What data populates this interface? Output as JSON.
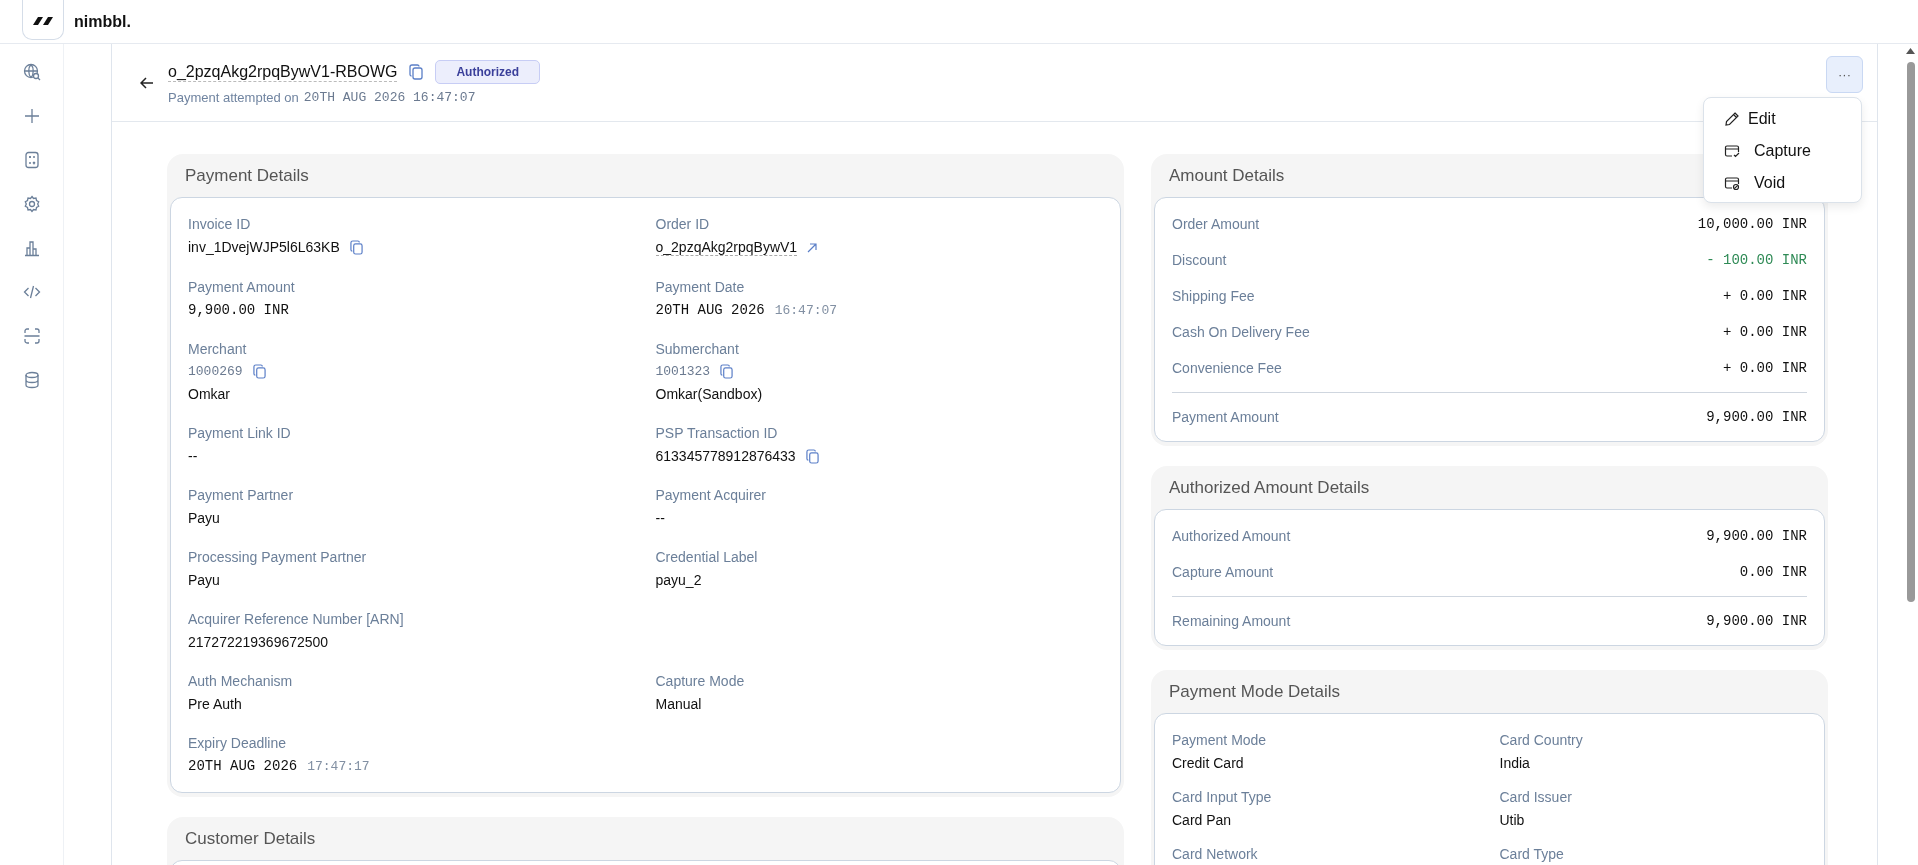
{
  "brand": {
    "name": "nimbbl."
  },
  "header": {
    "title": "o_2pzqAkg2rpqBywV1-RBOWG",
    "status": "Authorized",
    "subtitle_prefix": "Payment attempted on",
    "subtitle_date": "20TH AUG 2026 16:47:07",
    "more": "···"
  },
  "menu": [
    {
      "kind": "edit",
      "label": "Edit"
    },
    {
      "kind": "capture",
      "label": "Capture"
    },
    {
      "kind": "void",
      "label": "Void"
    }
  ],
  "payment_details": {
    "title": "Payment Details",
    "rows": [
      {
        "left": {
          "kind": "copy",
          "label": "Invoice ID",
          "value": "inv_1DvejWJP5l6L63KB"
        },
        "right": {
          "kind": "link",
          "label": "Order ID",
          "value": "o_2pzqAkg2rpqBywV1"
        }
      },
      {
        "left": {
          "kind": "mono",
          "label": "Payment Amount",
          "value": "9,900.00 INR"
        },
        "right": {
          "kind": "datetime",
          "label": "Payment Date",
          "value": "20TH AUG 2026",
          "time": "16:47:07"
        }
      },
      {
        "left": {
          "kind": "merchant",
          "label": "Merchant",
          "id": "1000269",
          "value": "Omkar"
        },
        "right": {
          "kind": "merchant",
          "label": "Submerchant",
          "id": "1001323",
          "value": "Omkar(Sandbox)"
        }
      },
      {
        "left": {
          "kind": "text",
          "label": "Payment Link ID",
          "value": "--"
        },
        "right": {
          "kind": "copy",
          "label": "PSP Transaction ID",
          "value": "613345778912876433"
        }
      },
      {
        "left": {
          "kind": "text",
          "label": "Payment Partner",
          "value": "Payu"
        },
        "right": {
          "kind": "text",
          "label": "Payment Acquirer",
          "value": "--"
        }
      },
      {
        "left": {
          "kind": "text",
          "label": "Processing Payment Partner",
          "value": "Payu"
        },
        "right": {
          "kind": "text",
          "label": "Credential Label",
          "value": "payu_2"
        }
      },
      {
        "left": {
          "kind": "text",
          "label": "Acquirer Reference Number [ARN]",
          "value": "217272219369672500"
        }
      },
      {
        "left": {
          "kind": "text",
          "label": "Auth Mechanism",
          "value": "Pre Auth"
        },
        "right": {
          "kind": "text",
          "label": "Capture Mode",
          "value": "Manual"
        }
      },
      {
        "left": {
          "kind": "datetime",
          "label": "Expiry Deadline",
          "value": "20TH AUG 2026",
          "time": "17:47:17"
        }
      }
    ]
  },
  "customer_details": {
    "title": "Customer Details"
  },
  "amount_details": {
    "title": "Amount Details",
    "rows": [
      {
        "kind": "normal",
        "label": "Order Amount",
        "value": "10,000.00 INR"
      },
      {
        "kind": "discount",
        "label": "Discount",
        "value": "- 100.00 INR"
      },
      {
        "kind": "normal",
        "label": "Shipping Fee",
        "value": "+ 0.00 INR"
      },
      {
        "kind": "normal",
        "label": "Cash On Delivery Fee",
        "value": "+ 0.00 INR"
      },
      {
        "kind": "normal",
        "label": "Convenience Fee",
        "value": "+ 0.00 INR"
      }
    ],
    "total": {
      "label": "Payment Amount",
      "value": "9,900.00 INR"
    }
  },
  "authorized_amount_details": {
    "title": "Authorized Amount Details",
    "rows": [
      {
        "label": "Authorized Amount",
        "value": "9,900.00 INR"
      },
      {
        "label": "Capture Amount",
        "value": "0.00 INR"
      }
    ],
    "total": {
      "label": "Remaining Amount",
      "value": "9,900.00 INR"
    }
  },
  "payment_mode_details": {
    "title": "Payment Mode Details",
    "fields": [
      {
        "label": "Payment Mode",
        "value": "Credit Card"
      },
      {
        "label": "Card Country",
        "value": "India"
      },
      {
        "label": "Card Input Type",
        "value": "Card Pan"
      },
      {
        "label": "Card Issuer",
        "value": "Utib"
      },
      {
        "label": "Card Network"
      },
      {
        "label": "Card Type"
      }
    ]
  }
}
